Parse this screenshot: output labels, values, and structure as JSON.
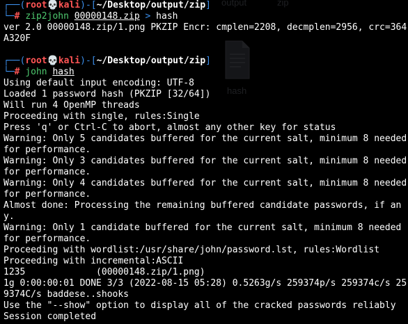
{
  "terminal": {
    "prompt": {
      "bracket_open": "┌──(",
      "user": "root",
      "skull": "💀",
      "host": "kali",
      "bracket_mid": ")-[",
      "cwd": "~/Desktop/output/zip",
      "bracket_close": "]",
      "line2_prefix": "└─",
      "hash_symbol": "#"
    },
    "command1": {
      "program": "zip2john",
      "arg": "00000148.zip",
      "redirect": ">",
      "target": "hash"
    },
    "output1": "ver 2.0 00000148.zip/1.png PKZIP Encr: cmplen=2208, decmplen=2956, crc=364A320F",
    "command2": {
      "program": "john",
      "arg": "hash"
    },
    "output2": [
      "Using default input encoding: UTF-8",
      "Loaded 1 password hash (PKZIP [32/64])",
      "Will run 4 OpenMP threads",
      "Proceeding with single, rules:Single",
      "Press 'q' or Ctrl-C to abort, almost any other key for status",
      "Warning: Only 5 candidates buffered for the current salt, minimum 8 needed for performance.",
      "Warning: Only 3 candidates buffered for the current salt, minimum 8 needed for performance.",
      "Warning: Only 4 candidates buffered for the current salt, minimum 8 needed for performance.",
      "Almost done: Processing the remaining buffered candidate passwords, if any.",
      "Warning: Only 1 candidate buffered for the current salt, minimum 8 needed for performance.",
      "Proceeding with wordlist:/usr/share/john/password.lst, rules:Wordlist",
      "Proceeding with incremental:ASCII",
      "1235             (00000148.zip/1.png)",
      "1g 0:00:00:01 DONE 3/3 (2022-08-15 05:28) 0.5263g/s 259374p/s 259374c/s 259374C/s baddese..shooks",
      "Use the \"--show\" option to display all of the cracked passwords reliably",
      "Session completed"
    ]
  },
  "desktop_ghost": {
    "top_label_1": "output",
    "top_label_2": "zip",
    "file_label": "hash",
    "file_icon": "document-icon"
  },
  "colors": {
    "background": "#000000",
    "prompt_frame": "#3b8eea",
    "user_host": "#ff5555",
    "command": "#4ec96f",
    "text": "#ffffff"
  }
}
